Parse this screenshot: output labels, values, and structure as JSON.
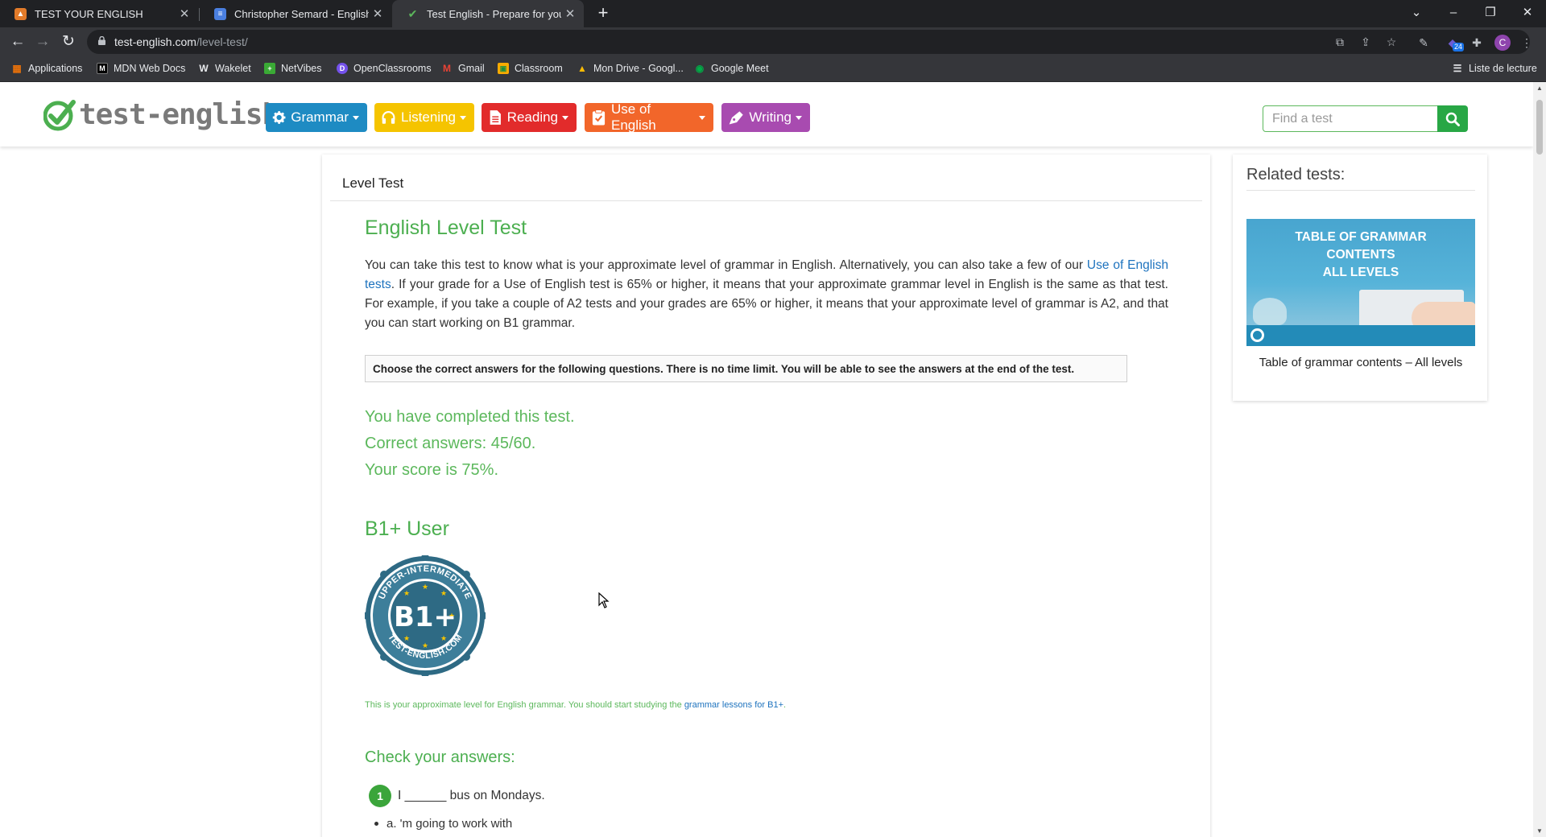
{
  "browser": {
    "tabs": [
      {
        "title": "TEST YOUR ENGLISH",
        "active": false
      },
      {
        "title": "Christopher Semard - English Lev",
        "active": false
      },
      {
        "title": "Test English - Prepare for your En",
        "active": true
      }
    ],
    "url_host": "test-english.com",
    "url_path": "/level-test/",
    "extension_badge": "24",
    "profile_initial": "C",
    "bookmarks": [
      {
        "label": "Applications"
      },
      {
        "label": "MDN Web Docs"
      },
      {
        "label": "Wakelet"
      },
      {
        "label": "NetVibes"
      },
      {
        "label": "OpenClassrooms"
      },
      {
        "label": "Gmail"
      },
      {
        "label": "Classroom"
      },
      {
        "label": "Mon Drive - Googl..."
      },
      {
        "label": "Google Meet"
      }
    ],
    "reading_list": "Liste de lecture"
  },
  "site": {
    "logo_text": "test-english",
    "nav": [
      {
        "label": "Grammar",
        "color": "#1e8bc3"
      },
      {
        "label": "Listening",
        "color": "#f5c400"
      },
      {
        "label": "Reading",
        "color": "#e22b2b"
      },
      {
        "label": "Use of English",
        "color": "#f2662a"
      },
      {
        "label": "Writing",
        "color": "#a84bb0"
      }
    ],
    "search_placeholder": "Find a test"
  },
  "main": {
    "breadcrumb": "Level Test",
    "title": "English Level Test",
    "intro_before_link": "You can take this test to know what is your approximate level of grammar in English. Alternatively, you can also take a few of our ",
    "intro_link": "Use of English tests",
    "intro_after_link": ". If your grade for a Use of English test is 65% or higher, it means that your approximate grammar level in English is the same as that test. For example, if you take a couple of A2 tests and your grades are 65% or higher, it means that your approximate level of grammar is A2, and that you can start working on B1 grammar.",
    "instructions": "Choose the correct answers for the following questions. There is no time limit. You will be able to see the answers at the end of the test.",
    "completed": "You have completed this test.",
    "correct": "Correct answers: 45/60.",
    "score": "Your score is 75%.",
    "level_title": "B1+ User",
    "badge": {
      "level": "B1+",
      "ring_top": "UPPER-INTERMEDIATE",
      "ring_bottom": "TEST-ENGLISH.COM"
    },
    "approx_before": "This is your approximate level for English grammar. You should start studying the ",
    "approx_link": "grammar lessons for B1+",
    "approx_after": ".",
    "check_title": "Check your answers:",
    "question": {
      "number": "1",
      "text": "I ______ bus on Mondays."
    },
    "option_a": "a. 'm going to work with"
  },
  "sidebar": {
    "title": "Related tests:",
    "thumb_lines": [
      "TABLE OF GRAMMAR",
      "CONTENTS",
      "ALL LEVELS"
    ],
    "caption": "Table of grammar contents – All levels"
  }
}
